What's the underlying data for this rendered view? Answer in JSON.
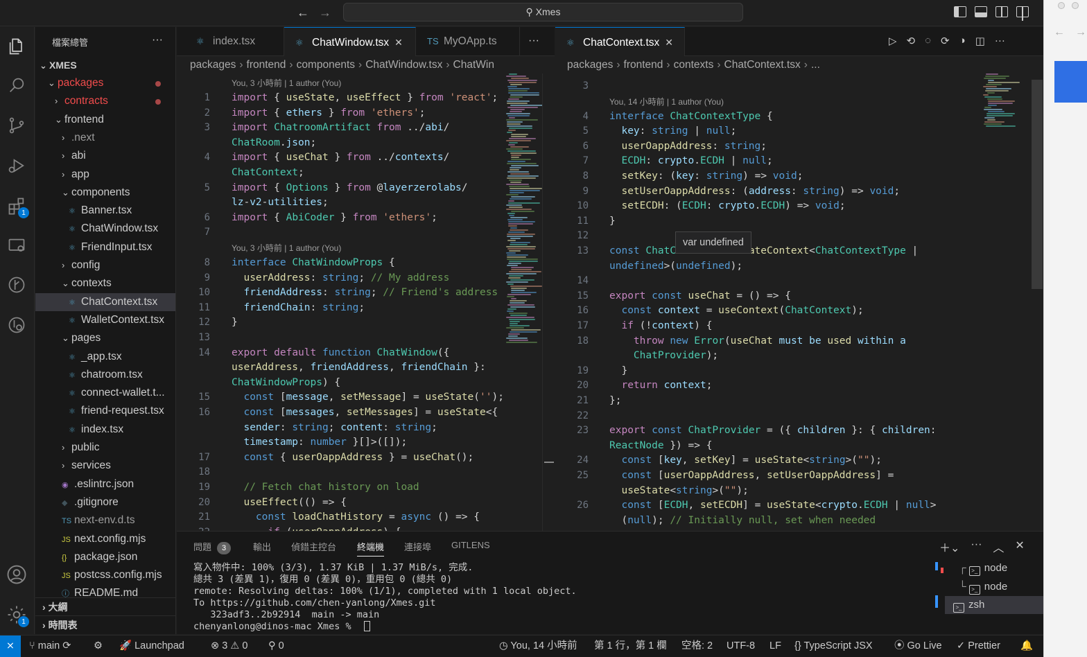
{
  "titlebar": {
    "search_text": "Xmes"
  },
  "explorer": {
    "title": "檔案總管",
    "root": "XMES",
    "rows": [
      {
        "label": "packages",
        "type": "folder-open",
        "indent": 1,
        "color": "red",
        "modified": true
      },
      {
        "label": "contracts",
        "type": "folder",
        "indent": 2,
        "color": "red",
        "modified": true
      },
      {
        "label": "frontend",
        "type": "folder-open",
        "indent": 2
      },
      {
        "label": ".next",
        "type": "folder",
        "indent": 3,
        "color": "dim"
      },
      {
        "label": "abi",
        "type": "folder",
        "indent": 3
      },
      {
        "label": "app",
        "type": "folder",
        "indent": 3
      },
      {
        "label": "components",
        "type": "folder-open",
        "indent": 3
      },
      {
        "label": "Banner.tsx",
        "type": "react",
        "indent": 4
      },
      {
        "label": "ChatWindow.tsx",
        "type": "react",
        "indent": 4
      },
      {
        "label": "FriendInput.tsx",
        "type": "react",
        "indent": 4
      },
      {
        "label": "config",
        "type": "folder",
        "indent": 3
      },
      {
        "label": "contexts",
        "type": "folder-open",
        "indent": 3
      },
      {
        "label": "ChatContext.tsx",
        "type": "react",
        "indent": 4,
        "selected": true
      },
      {
        "label": "WalletContext.tsx",
        "type": "react",
        "indent": 4
      },
      {
        "label": "pages",
        "type": "folder-open",
        "indent": 3
      },
      {
        "label": "_app.tsx",
        "type": "react",
        "indent": 4
      },
      {
        "label": "chatroom.tsx",
        "type": "react",
        "indent": 4
      },
      {
        "label": "connect-wallet.t...",
        "type": "react",
        "indent": 4
      },
      {
        "label": "friend-request.tsx",
        "type": "react",
        "indent": 4
      },
      {
        "label": "index.tsx",
        "type": "react",
        "indent": 4
      },
      {
        "label": "public",
        "type": "folder",
        "indent": 3
      },
      {
        "label": "services",
        "type": "folder",
        "indent": 3
      },
      {
        "label": ".eslintrc.json",
        "type": "eslint",
        "indent": 3
      },
      {
        "label": ".gitignore",
        "type": "git",
        "indent": 3
      },
      {
        "label": "next-env.d.ts",
        "type": "ts",
        "indent": 3,
        "color": "dim"
      },
      {
        "label": "next.config.mjs",
        "type": "js",
        "indent": 3
      },
      {
        "label": "package.json",
        "type": "json",
        "indent": 3
      },
      {
        "label": "postcss.config.mjs",
        "type": "js",
        "indent": 3
      },
      {
        "label": "README.md",
        "type": "info",
        "indent": 3
      }
    ],
    "outline": "大綱",
    "timeline": "時間表"
  },
  "icons": {
    "ts": "TS",
    "js": "JS",
    "json": "{}"
  },
  "left_editor": {
    "tabs": [
      {
        "label": "index.tsx",
        "active": false
      },
      {
        "label": "ChatWindow.tsx",
        "active": true
      },
      {
        "label": "MyOApp.ts",
        "active": false
      }
    ],
    "breadcrumb": [
      "packages",
      "frontend",
      "components",
      "ChatWindow.tsx",
      "ChatWin"
    ],
    "lens": [
      "You, 3 小時前 | 1 author (You)",
      "You, 3 小時前 | 1 author (You)"
    ],
    "line_numbers": [
      "1",
      "2",
      "3",
      "4",
      "5",
      "6",
      "7",
      "8",
      "9",
      "10",
      "11",
      "12",
      "13",
      "14",
      "15",
      "16",
      "17",
      "18",
      "19",
      "20",
      "21",
      "22"
    ],
    "lines": [
      "import { useState, useEffect } from 'react';",
      "import { ethers } from 'ethers';",
      "import ChatroomArtifact from '../abi/",
      "ChatRoom.json';",
      "import { useChat } from '../contexts/",
      "ChatContext';",
      "import { Options } from '@layerzerolabs/",
      "lz-v2-utilities';",
      "import { AbiCoder } from 'ethers';",
      "",
      "interface ChatWindowProps {",
      "  userAddress: string; // My address",
      "  friendAddress: string; // Friend's address",
      "  friendChain: string;",
      "}",
      "",
      "export default function ChatWindow({",
      "userAddress, friendAddress, friendChain }:",
      "ChatWindowProps) {",
      "  const [message, setMessage] = useState('');",
      "  const [messages, setMessages] = useState<{",
      "  sender: string; content: string;",
      "  timestamp: number }[]>([]);",
      "  const { userOappAddress } = useChat();",
      "",
      "  // Fetch chat history on load",
      "  useEffect(() => {",
      "    const loadChatHistory = async () => {",
      "      if (userOappAddress) {"
    ]
  },
  "right_editor": {
    "tabs": [
      {
        "label": "ChatContext.tsx",
        "active": true
      }
    ],
    "breadcrumb": [
      "packages",
      "frontend",
      "contexts",
      "ChatContext.tsx",
      "..."
    ],
    "lens": "You, 14 小時前 | 1 author (You)",
    "line_numbers": [
      "3",
      "4",
      "5",
      "6",
      "7",
      "8",
      "9",
      "10",
      "11",
      "12",
      "13",
      "14",
      "15",
      "16",
      "17",
      "18",
      "19",
      "20",
      "21",
      "22",
      "23",
      "24",
      "25",
      "26"
    ],
    "lines": [
      "",
      "interface ChatContextType {",
      "  key: string | null;",
      "  userOappAddress: string;",
      "  ECDH: crypto.ECDH | null;",
      "  setKey: (key: string) => void;",
      "  setUserOappAddress: (address: string) => void;",
      "  setECDH: (ECDH: crypto.ECDH) => void;",
      "}",
      "",
      "const ChatContext = createContext<ChatContextType |",
      "undefined>(undefined);",
      "",
      "export const useChat = () => {",
      "  const context = useContext(ChatContext);",
      "  if (!context) {",
      "    throw new Error('useChat must be used within a",
      "    ChatProvider');",
      "  }",
      "  return context;",
      "};",
      "",
      "export const ChatProvider = ({ children }: { children:",
      "ReactNode }) => {",
      "  const [key, setKey] = useState<string>(\"\");",
      "  const [userOappAddress, setUserOappAddress] =",
      "  useState<string>(\"\");",
      "  const [ECDH, setECDH] = useState<crypto.ECDH | null>",
      "  (null); // Initially null, set when needed"
    ],
    "hover": "var undefined"
  },
  "panel": {
    "tabs": [
      "問題",
      "輸出",
      "偵錯主控台",
      "終端機",
      "連接埠",
      "GITLENS"
    ],
    "problems_count": "3",
    "active_tab": "終端機",
    "terminal_lines": [
      "寫入物件中: 100% (3/3), 1.37 KiB | 1.37 MiB/s, 完成.",
      "總共 3 (差異 1)，復用 0 (差異 0)，重用包 0 (總共 0)",
      "remote: Resolving deltas: 100% (1/1), completed with 1 local object.",
      "To https://github.com/chen-yanlong/Xmes.git",
      "   323adf3..2b92914  main -> main",
      "chenyanlong@dinos-mac Xmes % "
    ],
    "terminals": [
      "node",
      "node",
      "zsh"
    ]
  },
  "statusbar": {
    "branch": "main",
    "launchpad": "Launchpad",
    "errors": "3",
    "warnings": "0",
    "ports": "0",
    "blame": "You, 14 小時前",
    "position": "第 1 行，第 1 欄",
    "spaces": "空格: 2",
    "encoding": "UTF-8",
    "eol": "LF",
    "language": "TypeScript JSX",
    "golive": "Go Live",
    "prettier": "Prettier"
  },
  "activity_badges": {
    "extensions": "1",
    "settings": "1"
  },
  "colors": {
    "accent": "#0078d4",
    "modified": "#f14c4c",
    "background": "#1f1f1f"
  }
}
